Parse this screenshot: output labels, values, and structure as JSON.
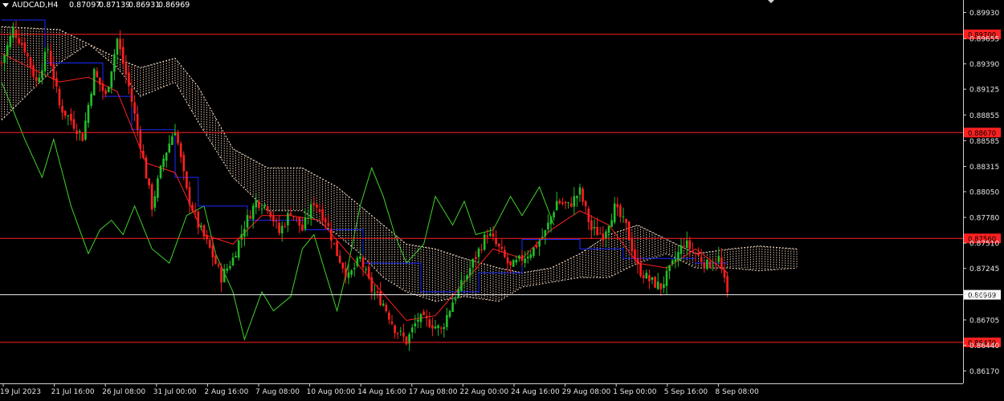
{
  "header": {
    "symbol": "AUDCAD,H4",
    "open": "0.87097",
    "high": "0.87139",
    "low": "0.86931",
    "close": "0.86969"
  },
  "chart_data": {
    "type": "candlestick",
    "ylim": [
      0.8604,
      0.9006
    ],
    "y_ticks": [
      "0.89930",
      "0.89655",
      "0.89390",
      "0.89125",
      "0.88855",
      "0.88585",
      "0.88315",
      "0.88050",
      "0.87780",
      "0.87510",
      "0.87245",
      "0.86975",
      "0.86705",
      "0.86440",
      "0.86170"
    ],
    "x_labels": [
      "19 Jul 2023",
      "21 Jul 16:00",
      "26 Jul 08:00",
      "31 Jul 00:00",
      "2 Aug 16:00",
      "7 Aug 08:00",
      "10 Aug 00:00",
      "14 Aug 16:00",
      "17 Aug 08:00",
      "22 Aug 00:00",
      "24 Aug 16:00",
      "29 Aug 08:00",
      "1 Sep 00:00",
      "5 Sep 16:00",
      "8 Sep 08:00"
    ],
    "levels": [
      {
        "label": "0.89700",
        "value": 0.897,
        "color": "#ff2020",
        "badge": "#ff2020"
      },
      {
        "label": "0.88670",
        "value": 0.8867,
        "color": "#ff2020",
        "badge": "#ff2020"
      },
      {
        "label": "0.87560",
        "value": 0.8756,
        "color": "#ff2020",
        "badge": "#ff2020"
      },
      {
        "label": "0.86969",
        "value": 0.86969,
        "color": "#e8e8e8",
        "badge": "#ffffff"
      },
      {
        "label": "0.86470",
        "value": 0.8647,
        "color": "#ff2020",
        "badge": "#ff2020"
      }
    ],
    "price_path": [
      [
        0,
        0.894
      ],
      [
        4,
        0.8975
      ],
      [
        8,
        0.8955
      ],
      [
        12,
        0.892
      ],
      [
        16,
        0.8955
      ],
      [
        20,
        0.8895
      ],
      [
        24,
        0.888
      ],
      [
        28,
        0.8862
      ],
      [
        32,
        0.893
      ],
      [
        36,
        0.8905
      ],
      [
        40,
        0.8965
      ],
      [
        44,
        0.8915
      ],
      [
        48,
        0.8855
      ],
      [
        52,
        0.879
      ],
      [
        56,
        0.884
      ],
      [
        60,
        0.8872
      ],
      [
        64,
        0.8805
      ],
      [
        68,
        0.877
      ],
      [
        72,
        0.8745
      ],
      [
        76,
        0.8715
      ],
      [
        80,
        0.8735
      ],
      [
        84,
        0.877
      ],
      [
        88,
        0.8795
      ],
      [
        92,
        0.879
      ],
      [
        96,
        0.8762
      ],
      [
        100,
        0.8785
      ],
      [
        104,
        0.8765
      ],
      [
        108,
        0.8795
      ],
      [
        112,
        0.8776
      ],
      [
        116,
        0.874
      ],
      [
        120,
        0.8715
      ],
      [
        124,
        0.8735
      ],
      [
        128,
        0.8702
      ],
      [
        132,
        0.8688
      ],
      [
        136,
        0.8662
      ],
      [
        140,
        0.8648
      ],
      [
        144,
        0.8672
      ],
      [
        148,
        0.8668
      ],
      [
        152,
        0.866
      ],
      [
        156,
        0.869
      ],
      [
        160,
        0.8712
      ],
      [
        164,
        0.8737
      ],
      [
        168,
        0.8762
      ],
      [
        172,
        0.8745
      ],
      [
        176,
        0.8725
      ],
      [
        180,
        0.8735
      ],
      [
        184,
        0.8745
      ],
      [
        188,
        0.8762
      ],
      [
        192,
        0.8795
      ],
      [
        196,
        0.879
      ],
      [
        200,
        0.8805
      ],
      [
        204,
        0.8765
      ],
      [
        208,
        0.876
      ],
      [
        212,
        0.8788
      ],
      [
        216,
        0.8768
      ],
      [
        220,
        0.8725
      ],
      [
        224,
        0.8712
      ],
      [
        228,
        0.8705
      ],
      [
        232,
        0.8728
      ],
      [
        236,
        0.8752
      ],
      [
        240,
        0.874
      ],
      [
        244,
        0.8728
      ],
      [
        248,
        0.8735
      ],
      [
        251,
        0.8697
      ]
    ],
    "tenkan_sen": [
      [
        0,
        0.895
      ],
      [
        10,
        0.8935
      ],
      [
        20,
        0.892
      ],
      [
        30,
        0.8925
      ],
      [
        40,
        0.891
      ],
      [
        50,
        0.8835
      ],
      [
        60,
        0.8825
      ],
      [
        70,
        0.876
      ],
      [
        80,
        0.875
      ],
      [
        90,
        0.878
      ],
      [
        100,
        0.878
      ],
      [
        110,
        0.8775
      ],
      [
        120,
        0.874
      ],
      [
        130,
        0.8705
      ],
      [
        140,
        0.867
      ],
      [
        150,
        0.8675
      ],
      [
        160,
        0.871
      ],
      [
        170,
        0.8745
      ],
      [
        180,
        0.8735
      ],
      [
        190,
        0.8765
      ],
      [
        200,
        0.8785
      ],
      [
        210,
        0.877
      ],
      [
        220,
        0.873
      ],
      [
        230,
        0.8725
      ],
      [
        240,
        0.8745
      ],
      [
        251,
        0.872
      ]
    ],
    "kijun_sen": [
      [
        0,
        0.8985
      ],
      [
        15,
        0.8985
      ],
      [
        15,
        0.894
      ],
      [
        35,
        0.894
      ],
      [
        35,
        0.8905
      ],
      [
        45,
        0.8905
      ],
      [
        45,
        0.887
      ],
      [
        60,
        0.887
      ],
      [
        60,
        0.882
      ],
      [
        68,
        0.882
      ],
      [
        68,
        0.879
      ],
      [
        85,
        0.879
      ],
      [
        85,
        0.8775
      ],
      [
        105,
        0.8775
      ],
      [
        105,
        0.8765
      ],
      [
        125,
        0.8765
      ],
      [
        125,
        0.873
      ],
      [
        145,
        0.873
      ],
      [
        145,
        0.87
      ],
      [
        165,
        0.87
      ],
      [
        165,
        0.872
      ],
      [
        180,
        0.872
      ],
      [
        180,
        0.8755
      ],
      [
        200,
        0.8755
      ],
      [
        200,
        0.8745
      ],
      [
        215,
        0.8745
      ],
      [
        215,
        0.8735
      ],
      [
        240,
        0.8735
      ],
      [
        240,
        0.873
      ],
      [
        251,
        0.873
      ]
    ],
    "chikou_span": [
      [
        0,
        0.892
      ],
      [
        8,
        0.886
      ],
      [
        14,
        0.882
      ],
      [
        18,
        0.886
      ],
      [
        24,
        0.879
      ],
      [
        30,
        0.874
      ],
      [
        34,
        0.8765
      ],
      [
        38,
        0.8775
      ],
      [
        42,
        0.876
      ],
      [
        46,
        0.879
      ],
      [
        52,
        0.8745
      ],
      [
        58,
        0.873
      ],
      [
        64,
        0.878
      ],
      [
        70,
        0.879
      ],
      [
        74,
        0.874
      ],
      [
        80,
        0.87
      ],
      [
        84,
        0.865
      ],
      [
        90,
        0.87
      ],
      [
        94,
        0.868
      ],
      [
        100,
        0.8695
      ],
      [
        104,
        0.8745
      ],
      [
        108,
        0.876
      ],
      [
        112,
        0.872
      ],
      [
        116,
        0.868
      ],
      [
        120,
        0.873
      ],
      [
        124,
        0.879
      ],
      [
        128,
        0.883
      ],
      [
        132,
        0.88
      ],
      [
        136,
        0.876
      ],
      [
        140,
        0.873
      ],
      [
        146,
        0.875
      ],
      [
        150,
        0.88
      ],
      [
        156,
        0.877
      ],
      [
        160,
        0.8795
      ],
      [
        164,
        0.876
      ],
      [
        170,
        0.8765
      ],
      [
        176,
        0.88
      ],
      [
        180,
        0.878
      ],
      [
        186,
        0.881
      ],
      [
        191,
        0.877
      ]
    ],
    "cloud": [
      [
        0,
        0.8978,
        0.888
      ],
      [
        20,
        0.8975,
        0.894
      ],
      [
        30,
        0.896,
        0.896
      ],
      [
        40,
        0.8945,
        0.8935
      ],
      [
        48,
        0.8935,
        0.8905
      ],
      [
        60,
        0.8945,
        0.892
      ],
      [
        68,
        0.8915,
        0.8878
      ],
      [
        80,
        0.885,
        0.882
      ],
      [
        92,
        0.883,
        0.8785
      ],
      [
        104,
        0.883,
        0.8785
      ],
      [
        116,
        0.881,
        0.876
      ],
      [
        124,
        0.879,
        0.874
      ],
      [
        132,
        0.877,
        0.8715
      ],
      [
        140,
        0.875,
        0.87
      ],
      [
        150,
        0.8745,
        0.869
      ],
      [
        160,
        0.8735,
        0.8695
      ],
      [
        172,
        0.8725,
        0.869
      ],
      [
        180,
        0.872,
        0.8705
      ],
      [
        190,
        0.8725,
        0.871
      ],
      [
        200,
        0.874,
        0.8715
      ],
      [
        210,
        0.876,
        0.8715
      ],
      [
        220,
        0.877,
        0.873
      ],
      [
        230,
        0.8755,
        0.874
      ],
      [
        240,
        0.874,
        0.8725
      ],
      [
        252,
        0.8745,
        0.8725
      ],
      [
        262,
        0.8748,
        0.8722
      ],
      [
        275,
        0.8745,
        0.8725
      ]
    ],
    "colors": {
      "up": "#22c02a",
      "down": "#ff2020",
      "tenkan": "#ff2020",
      "kijun": "#1a2bff",
      "chikou": "#3fd22a",
      "cloud": "#f3d8c0",
      "grid_axis": "#d0d0d0"
    }
  }
}
